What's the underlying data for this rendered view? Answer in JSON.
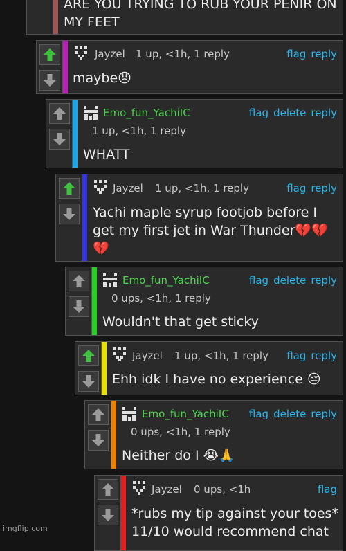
{
  "colors": {
    "upvote_active": "#3fc03f",
    "link": "#2ab4e8",
    "op_name": "#4cd44c",
    "bars": [
      "#9e5555",
      "#b820b8",
      "#1aa8e8",
      "#3535e0",
      "#25d025",
      "#e8e000",
      "#f08000",
      "#e02020"
    ]
  },
  "comments": [
    {
      "body": "ARE YOU TRYING TO RUB YOUR PENIR ON MY FEET"
    },
    {
      "user": "Jayzel",
      "meta": "1 up, <1h, 1 reply",
      "upvoted": true,
      "actions": {
        "flag": "flag",
        "reply": "reply"
      },
      "body": "maybe😞"
    },
    {
      "user": "Emo_fun_YachiIC",
      "meta": "1 up, <1h, 1 reply",
      "upvoted": false,
      "actions": {
        "flag": "flag",
        "delete": "delete",
        "reply": "reply"
      },
      "body": "WHATT"
    },
    {
      "user": "Jayzel",
      "meta": "1 up, <1h, 1 reply",
      "upvoted": true,
      "actions": {
        "flag": "flag",
        "reply": "reply"
      },
      "body": "Yachi maple syrup footjob before I get my first jet in War Thunder💔💔💔"
    },
    {
      "user": "Emo_fun_YachiIC",
      "meta": "0 ups, <1h, 1 reply",
      "upvoted": false,
      "actions": {
        "flag": "flag",
        "delete": "delete",
        "reply": "reply"
      },
      "body": "Wouldn't that get sticky"
    },
    {
      "user": "Jayzel",
      "meta": "1 up, <1h, 1 reply",
      "upvoted": true,
      "actions": {
        "flag": "flag",
        "reply": "reply"
      },
      "body": "Ehh idk I have no experience 😔"
    },
    {
      "user": "Emo_fun_YachiIC",
      "meta": "0 ups, <1h, 1 reply",
      "upvoted": false,
      "actions": {
        "flag": "flag",
        "delete": "delete",
        "reply": "reply"
      },
      "body": "Neither do I 😭🙏"
    },
    {
      "user": "Jayzel",
      "meta": "0 ups, <1h",
      "upvoted": false,
      "actions": {
        "flag": "flag"
      },
      "body": "*rubs my tip against your toes* 11/10 would recommend chat"
    }
  ],
  "watermark": "imgflip.com"
}
